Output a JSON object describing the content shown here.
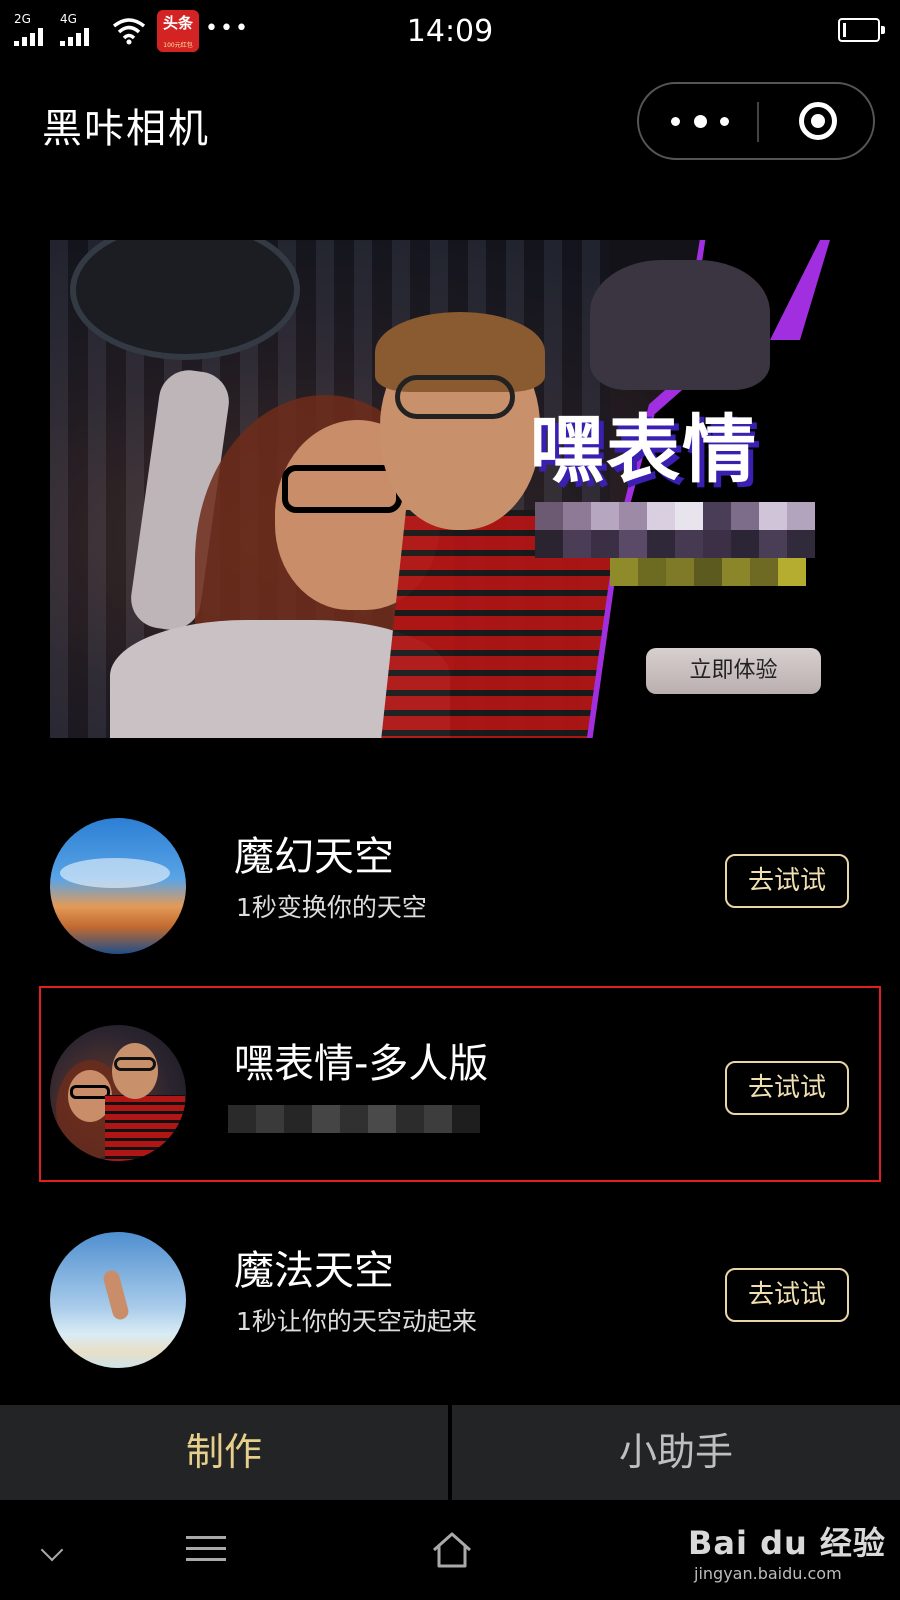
{
  "status_bar": {
    "signal_1_label": "2G",
    "signal_2_label": "4G",
    "notification_app_label": "头条",
    "notification_app_sub": "100元红包",
    "more_indicator": "•••",
    "time": "14:09",
    "battery_level": 0.1
  },
  "header": {
    "title": "黑咔相机",
    "capsule_more_icon": "more-dots-icon",
    "capsule_close_icon": "target-icon"
  },
  "banner": {
    "heading": "嘿表情",
    "cta_label": "立即体验",
    "accent_color": "#a12fe0"
  },
  "features": [
    {
      "title": "魔幻天空",
      "subtitle": "1秒变换你的天空",
      "button": "去试试",
      "avatar": "sky-sunset"
    },
    {
      "title": "嘿表情-多人版",
      "subtitle": "",
      "button": "去试试",
      "avatar": "couple-glasses",
      "highlighted": true
    },
    {
      "title": "魔法天空",
      "subtitle": "1秒让你的天空动起来",
      "button": "去试试",
      "avatar": "sky-beach"
    }
  ],
  "tabbar": {
    "tabs": [
      {
        "label": "制作",
        "active": true
      },
      {
        "label": "小助手",
        "active": false
      }
    ],
    "active_color": "#e6cf8a"
  },
  "system_nav": {
    "watermark_main": "Bai du 经验",
    "watermark_sub": "jingyan.baidu.com"
  },
  "colors": {
    "button_border": "#e8d6a6",
    "highlight_border": "#e02020",
    "background": "#000000"
  }
}
